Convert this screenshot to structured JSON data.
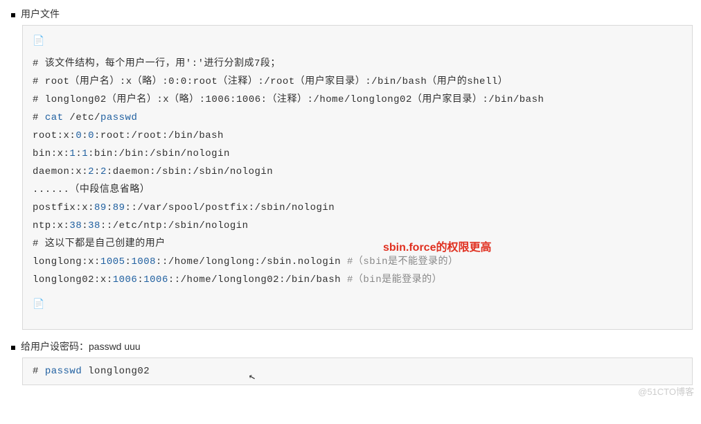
{
  "section1": {
    "title": "用户文件",
    "lines": [
      "# 该文件结构，每个用户一行，用':'进行分割成7段；",
      "# root（用户名）:x（略）:0:0:root（注释）:/root（用户家目录）:/bin/bash（用户的shell）",
      "# longlong02（用户名）:x（略）:1006:1006:（注释）:/home/longlong02（用户家目录）:/bin/bash",
      "",
      "# cat /etc/passwd",
      "root:x:0:0:root:/root:/bin/bash",
      "bin:x:1:1:bin:/bin:/sbin/nologin",
      "daemon:x:2:2:daemon:/sbin:/sbin/nologin",
      "......（中段信息省略）",
      "postfix:x:89:89::/var/spool/postfix:/sbin/nologin",
      "ntp:x:38:38::/etc/ntp:/sbin/nologin",
      "# 这以下都是自己创建的用户",
      "longlong:x:1005:1008::/home/longlong:/sbin.nologin #（sbin是不能登录的）",
      "longlong02:x:1006:1006::/home/longlong02:/bin/bash #（bin是能登录的）"
    ]
  },
  "red_note": "sbin.force的权限更高",
  "section2": {
    "title": "给用户设密码：passwd uuu",
    "line": "# passwd longlong02"
  },
  "watermark": "@51CTO博客"
}
